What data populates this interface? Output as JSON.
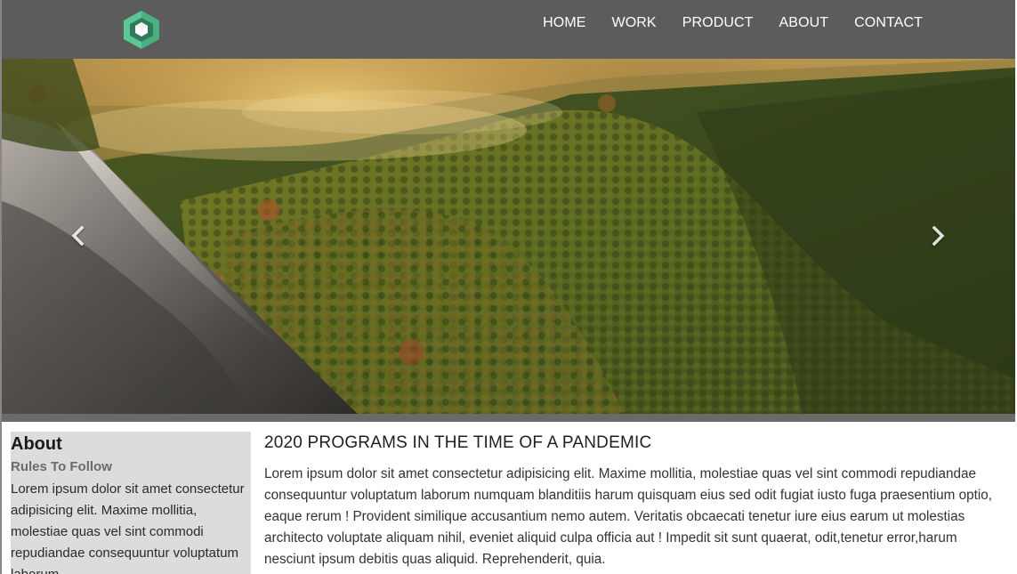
{
  "header": {
    "logo_icon": "hexagon-cube-logo-icon",
    "brand_colors": {
      "outer": "#4fb888",
      "inner": "#2f7a5a",
      "core": "#ffffff"
    },
    "nav": [
      {
        "label": "HOME"
      },
      {
        "label": "WORK"
      },
      {
        "label": "PRODUCT"
      },
      {
        "label": "ABOUT"
      },
      {
        "label": "CONTACT"
      }
    ]
  },
  "hero": {
    "prev_icon": "chevron-left-icon",
    "next_icon": "chevron-right-icon"
  },
  "sidebar": {
    "title": "About",
    "subtitle": "Rules To Follow",
    "text": "Lorem ipsum dolor sit amet consectetur adipisicing elit. Maxime mollitia, molestiae quas vel sint commodi repudiandae consequuntur voluptatum laborum"
  },
  "main": {
    "heading": "2020 PROGRAMS IN THE TIME OF A PANDEMIC",
    "text": "Lorem ipsum dolor sit amet consectetur adipisicing elit. Maxime mollitia, molestiae quas vel sint commodi repudiandae consequuntur voluptatum laborum numquam blanditiis harum quisquam eius sed odit fugiat iusto fuga praesentium optio, eaque rerum ! Provident similique accusantium nemo autem. Veritatis obcaecati tenetur iure eius earum ut molestias architecto voluptate aliquam nihil, eveniet aliquid culpa officia aut ! Impedit sit sunt quaerat, odit,tenetur error,harum nesciunt ipsum debitis quas aliquid. Reprehenderit, quia."
  }
}
